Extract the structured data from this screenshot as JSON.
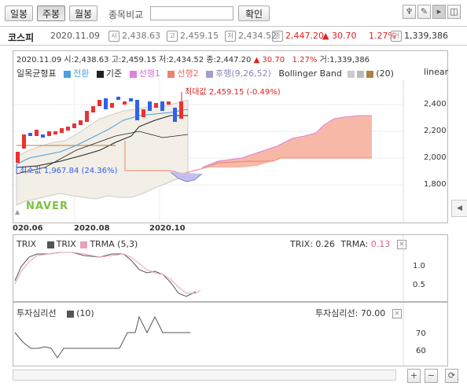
{
  "toolbar": {
    "daily": "일봉",
    "weekly": "주봉",
    "monthly": "월봉",
    "compare_label": "종목비교",
    "compare_placeholder": "",
    "confirm": "확인",
    "tool_icons": [
      "wrench-icon",
      "pencil-icon",
      "cursor-icon",
      "split-icon"
    ]
  },
  "quote": {
    "name": "코스피",
    "date": "2020.11.09",
    "open_icon": "시",
    "open": "2,438.63",
    "high_icon": "고",
    "high": "2,459.15",
    "low_icon": "저",
    "low": "2,434.52",
    "close_icon": "종",
    "close": "2,447.20",
    "change": "▲ 30.70",
    "pct": "1.27%",
    "vol_icon": "거",
    "volume": "1,339,386"
  },
  "chart_info": {
    "text": "2020.11.09 시:2,438.63 고:2,459.15 저:2,434.52 종:2,447.20",
    "change": "▲    30.70",
    "pct": "1.27%",
    "volume": "거:1,339,386"
  },
  "legend_main": {
    "title": "일목균형표",
    "items": [
      {
        "label": "전환",
        "color": "#4aa0e0"
      },
      {
        "label": "기준",
        "color": "#222222"
      },
      {
        "label": "선행1",
        "color": "#e080e0"
      },
      {
        "label": "선행2",
        "color": "#f08070"
      },
      {
        "label": "후행(9,26,52)",
        "color": "#a0a0d0"
      },
      {
        "label": "Bollinger Band",
        "color": "#bbbbbb"
      },
      {
        "label": "(20)",
        "color": "#b08040"
      }
    ],
    "scale": "linear"
  },
  "main_chart": {
    "max_label": "최대값 2,459.15 (-0.49%)",
    "min_label": "최소값 1,967.84 (24.36%)",
    "watermark": "NAVER",
    "y_ticks": [
      "2,400",
      "2,200",
      "2,000",
      "1,800"
    ],
    "x_ticks": [
      "020.06",
      "2020.08",
      "2020.10"
    ]
  },
  "trix": {
    "title": "TRIX",
    "legend": [
      "TRIX",
      "TRMA (5,3)"
    ],
    "value_label": "TRIX:",
    "value": "0.26",
    "trma_label": "TRMA:",
    "trma": "0.13",
    "y_ticks": [
      "1.0",
      "0.5"
    ]
  },
  "psy": {
    "title": "투자심리선",
    "legend": "(10)",
    "value_label": "투자심리선:",
    "value": "70.00",
    "y_ticks": [
      "70",
      "60"
    ]
  },
  "bottom_controls": [
    "+",
    "−",
    "refresh"
  ]
}
